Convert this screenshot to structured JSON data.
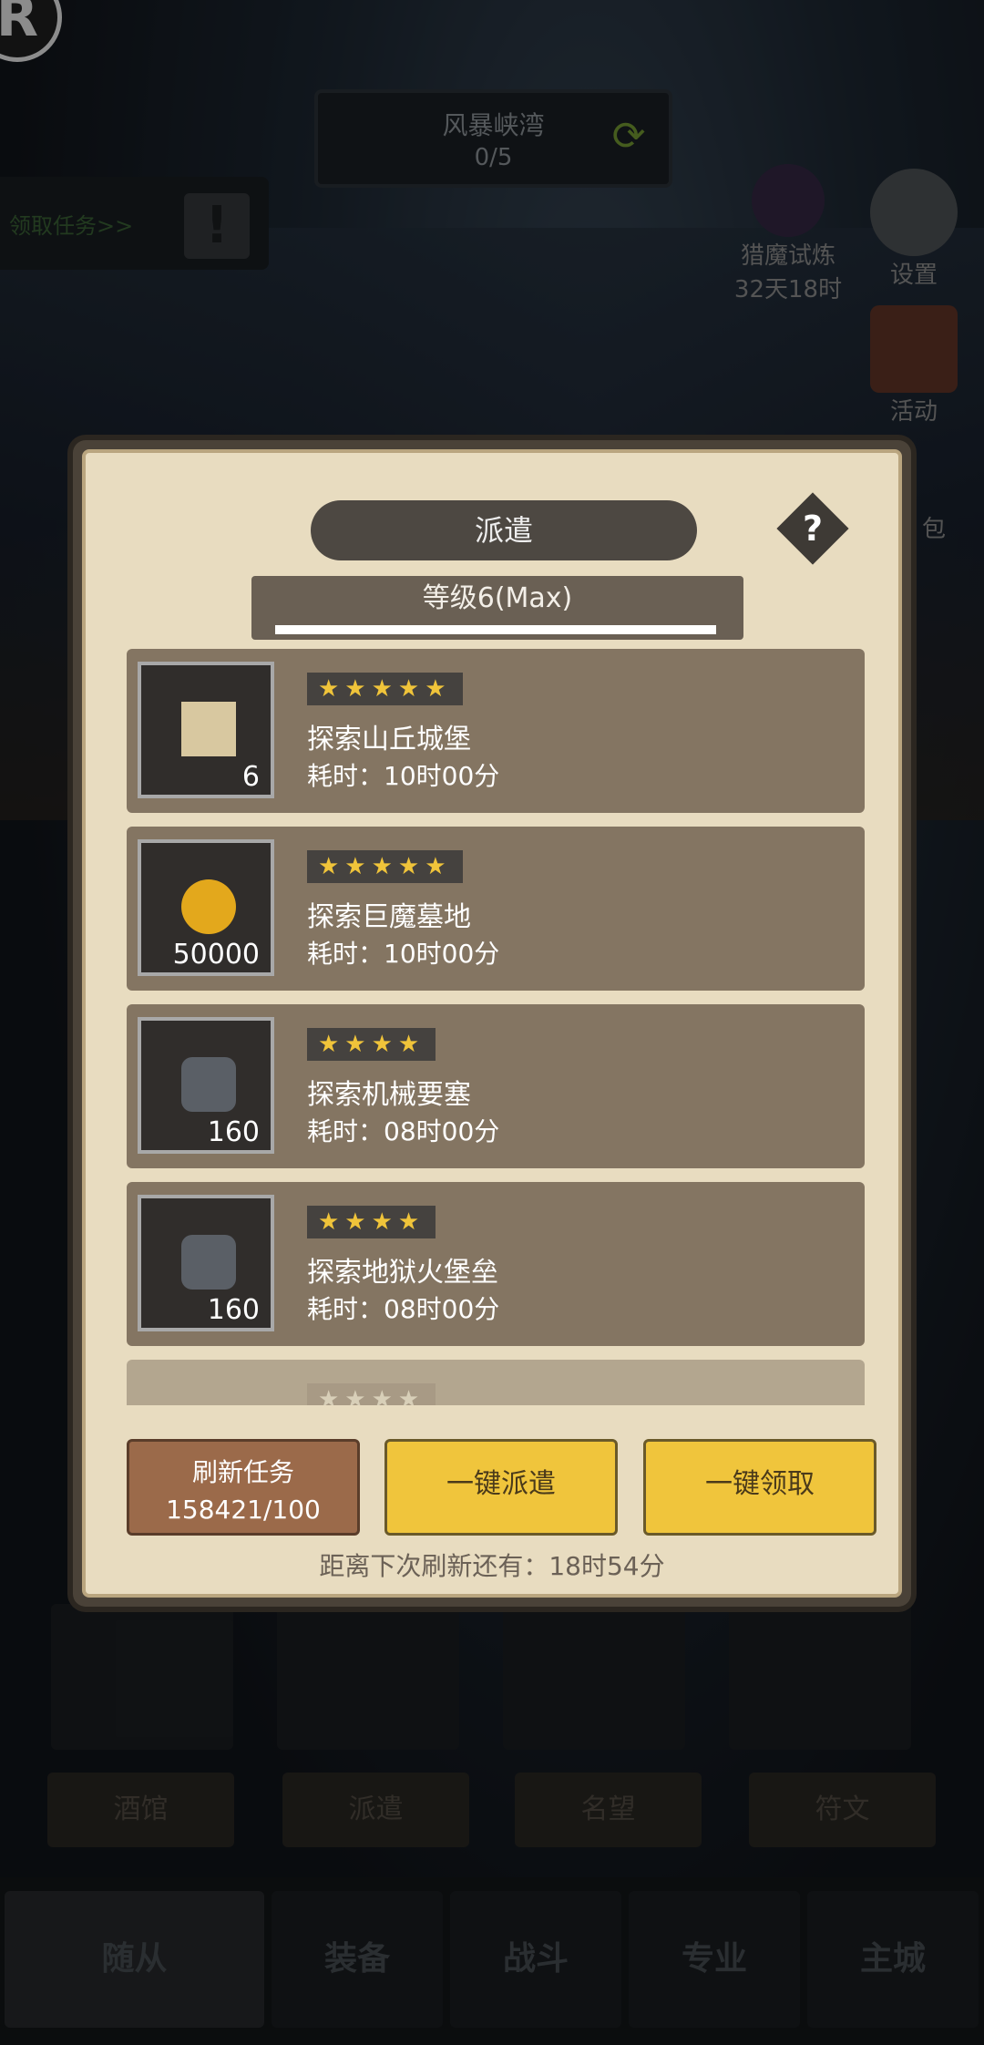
{
  "quest": {
    "title": "风暴峡湾",
    "progress": "0/5"
  },
  "task_link": "领取任务>>",
  "side": {
    "hunt_title": "猎魔试炼",
    "hunt_time": "32天18时",
    "settings": "设置",
    "activity": "活动",
    "bag": "包"
  },
  "dialog": {
    "title": "派遣",
    "help": "?",
    "level": "等级6(Max)",
    "level_fill": 1.0,
    "missions": [
      {
        "name": "探索山丘城堡",
        "time": "耗时：10时00分",
        "stars": "★★★★★",
        "count": "6",
        "icon": "scroll-icon"
      },
      {
        "name": "探索巨魔墓地",
        "time": "耗时：10时00分",
        "stars": "★★★★★",
        "count": "50000",
        "icon": "gold-coin-icon"
      },
      {
        "name": "探索机械要塞",
        "time": "耗时：08时00分",
        "stars": "★★★★",
        "count": "160",
        "icon": "rune-stone-icon"
      },
      {
        "name": "探索地狱火堡垒",
        "time": "耗时：08时00分",
        "stars": "★★★★",
        "count": "160",
        "icon": "rune-stone-icon"
      },
      {
        "stars": "★★★★"
      }
    ],
    "refresh_button": {
      "label": "刷新任务",
      "cost": "158421/100"
    },
    "dispatch_all": "一键派遣",
    "claim_all": "一键领取",
    "refresh_info": "距离下次刷新还有：18时54分"
  },
  "sub_tabs": [
    "酒馆",
    "派遣",
    "名望",
    "符文"
  ],
  "nav": [
    "随从",
    "装备",
    "战斗",
    "专业",
    "主城"
  ],
  "colors": {
    "gold": "#f0c53c",
    "panel": "#e8dcc0",
    "row": "#847562",
    "star": "#f0c43a"
  }
}
